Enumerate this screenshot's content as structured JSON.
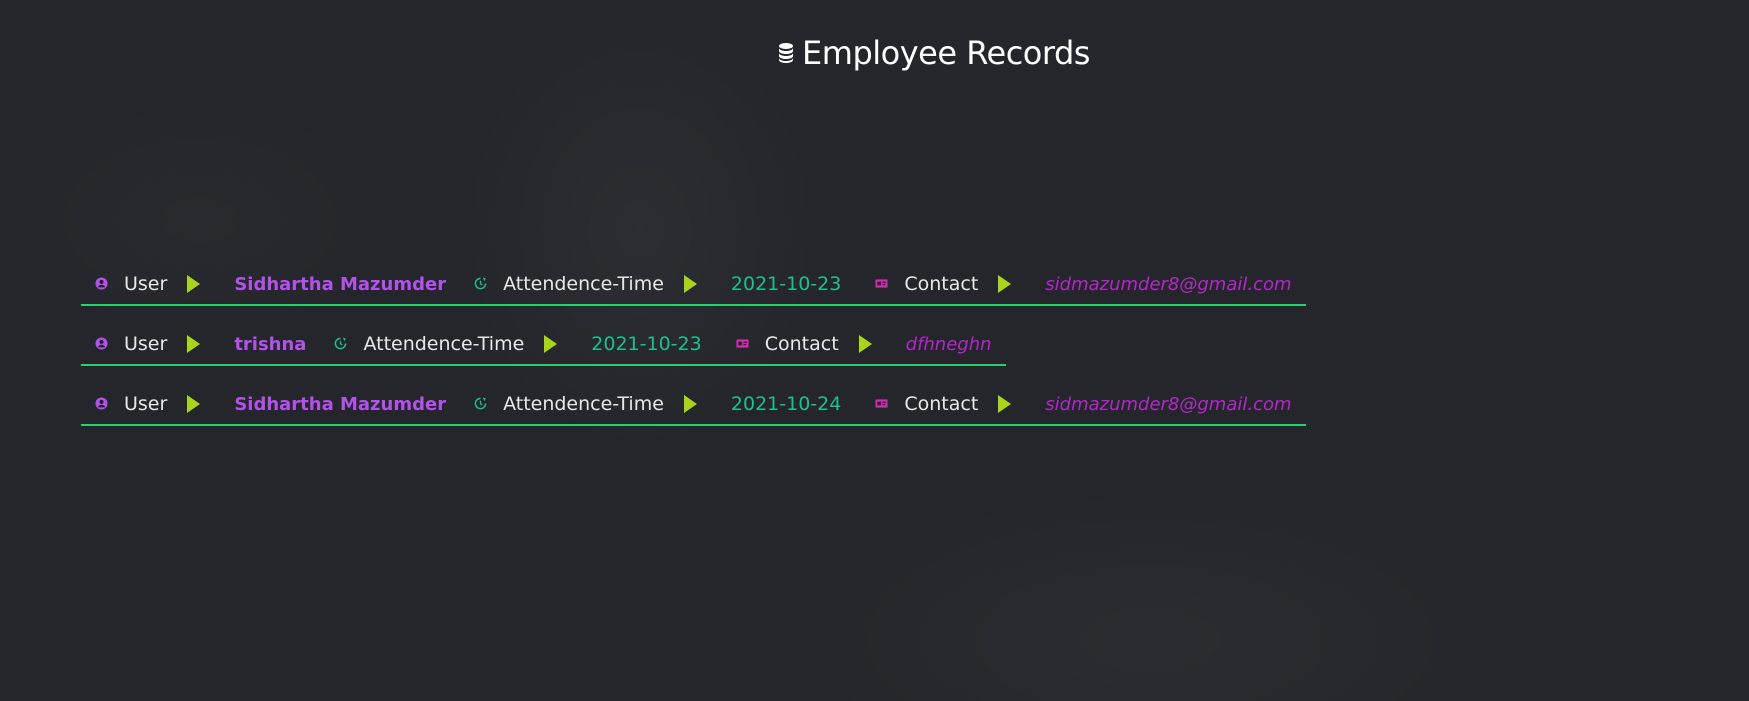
{
  "page": {
    "title": "Employee Records",
    "title_icon": "database-icon"
  },
  "labels": {
    "user": "User",
    "attendance": "Attendence-Time",
    "contact": "Contact"
  },
  "colors": {
    "background": "#24262b",
    "name": "#b252e8",
    "date": "#1fbf8f",
    "email": "#b228c8",
    "arrow": "#a8d41c",
    "underline": "#2ecc71"
  },
  "records": [
    {
      "name": "Sidhartha Mazumder",
      "date": "2021-10-23",
      "contact": "sidmazumder8@gmail.com"
    },
    {
      "name": "trishna",
      "date": "2021-10-23",
      "contact": "dfhneghn"
    },
    {
      "name": "Sidhartha Mazumder",
      "date": "2021-10-24",
      "contact": "sidmazumder8@gmail.com"
    }
  ]
}
